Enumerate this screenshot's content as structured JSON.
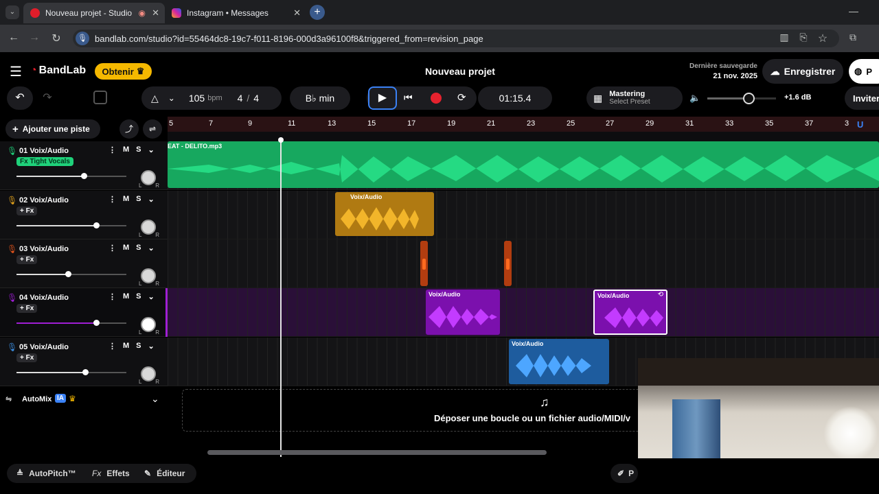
{
  "browser": {
    "tabs": [
      {
        "title": "Nouveau projet - Studio",
        "active": true
      },
      {
        "title": "Instagram • Messages",
        "active": false
      }
    ],
    "url": "bandlab.com/studio?id=55464dc8-19c7-f011-8196-000d3a96100f8&triggered_from=revision_page"
  },
  "header": {
    "brand": "BandLab",
    "obtain": "Obtenir",
    "project_title": "Nouveau projet",
    "last_save_label": "Dernière sauvegarde",
    "last_save_date": "21 nov. 2025",
    "save_button": "Enregistrer",
    "profile_partial": "P"
  },
  "transport": {
    "tempo": "105",
    "tempo_unit": "bpm",
    "time_sig_top": "4",
    "time_sig_bottom": "4",
    "key": "B♭ min",
    "time": "01:15.4",
    "mastering_title": "Mastering",
    "mastering_sub": "Select Preset",
    "volume_db": "+1.6 dB",
    "invite": "Inviter"
  },
  "toolbar": {
    "add_track": "Ajouter une piste"
  },
  "ruler": [
    "5",
    "7",
    "9",
    "11",
    "13",
    "15",
    "17",
    "19",
    "21",
    "23",
    "25",
    "27",
    "29",
    "31",
    "33",
    "35",
    "37",
    "3"
  ],
  "tracks": [
    {
      "num": "01",
      "name": "Voix/Audio",
      "fx": "Fx Tight Vocals",
      "color": "#1fd17a",
      "vol": 0.6
    },
    {
      "num": "02",
      "name": "Voix/Audio",
      "fx": "+ Fx",
      "color": "#e3a31c",
      "vol": 0.73
    },
    {
      "num": "03",
      "name": "Voix/Audio",
      "fx": "+ Fx",
      "color": "#e2541c",
      "vol": 0.47
    },
    {
      "num": "04",
      "name": "Voix/Audio",
      "fx": "+ Fx",
      "color": "#a01ed6",
      "vol": 0.73
    },
    {
      "num": "05",
      "name": "Voix/Audio",
      "fx": "+ Fx",
      "color": "#3b8de0",
      "vol": 0.63
    }
  ],
  "clips": {
    "track1": "EAT - DELITO.mp3",
    "track2": "Voix/Audio",
    "track4a": "Voix/Audio",
    "track4b": "Voix/Audio",
    "track5": "Voix/Audio"
  },
  "mute_label": "M",
  "solo_label": "S",
  "automix": {
    "label": "AutoMix",
    "badge": "IA"
  },
  "dropzone": "Déposer une boucle ou un fichier audio/MIDI/v",
  "bottom": {
    "autopitch": "AutoPitch™",
    "effects": "Effets",
    "editor": "Éditeur",
    "p_partial": "P"
  }
}
